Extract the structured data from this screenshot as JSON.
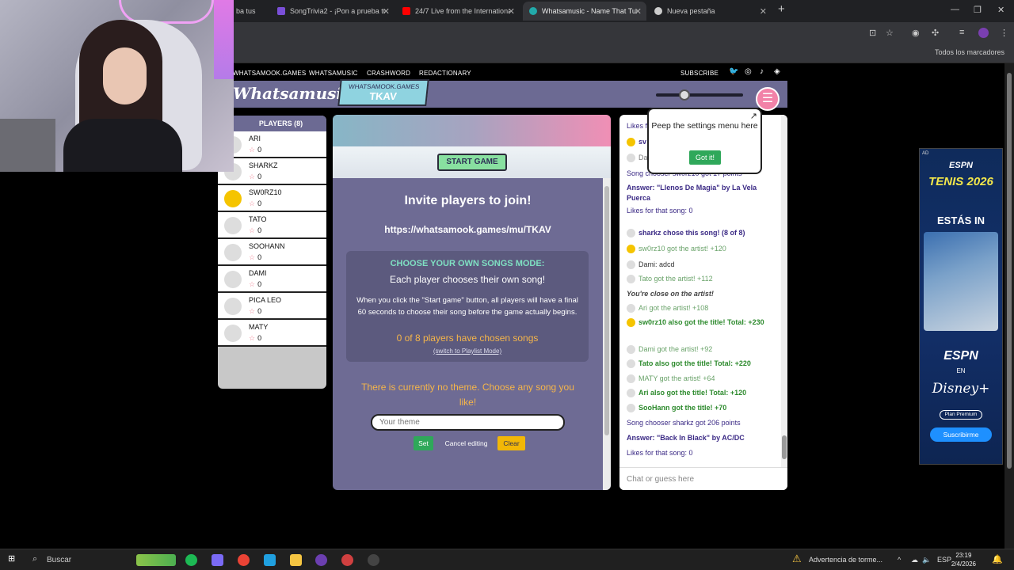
{
  "browser": {
    "tabs": [
      {
        "label": "ba tus",
        "icon": "music-icon",
        "color": "#666"
      },
      {
        "label": "SongTrivia2 - ¡Pon a prueba tus",
        "icon": "songtrivia-icon",
        "color": "#7a4fd8"
      },
      {
        "label": "24/7 Live from the International",
        "icon": "youtube-icon",
        "color": "#ff0000"
      },
      {
        "label": "Whatsamusic - Name That Tune",
        "icon": "whatsamusic-icon",
        "color": "#2aa"
      },
      {
        "label": "Nueva pestaña",
        "icon": "chrome-icon",
        "color": "#ccc"
      }
    ],
    "new_tab": "+",
    "bookmarks_label": "Todos los marcadores"
  },
  "site": {
    "nav": [
      "WHATSAMOOK.GAMES",
      "WHATSAMUSIC",
      "CRASHWORD",
      "REDACTIONARY"
    ],
    "subscribe": "SUBSCRIBE",
    "logo": "Whatsamusic",
    "room_site": "WHATSAMOOK.GAMES",
    "room_code": "TKAV",
    "menu_icon": "hamburger-icon",
    "volume_level": 0.3
  },
  "players": {
    "header": "PLAYERS (8)",
    "list": [
      {
        "name": "ARI",
        "score": "0",
        "gold": false
      },
      {
        "name": "SHARKZ",
        "score": "0",
        "gold": false
      },
      {
        "name": "SW0RZ10",
        "score": "0",
        "gold": true
      },
      {
        "name": "TATO",
        "score": "0",
        "gold": false
      },
      {
        "name": "SOOHANN",
        "score": "0",
        "gold": false
      },
      {
        "name": "DAMI",
        "score": "0",
        "gold": false
      },
      {
        "name": "PICA LEO",
        "score": "0",
        "gold": false
      },
      {
        "name": "MATY",
        "score": "0",
        "gold": false
      }
    ]
  },
  "main": {
    "start_label": "START GAME",
    "invite_title": "Invite players to join!",
    "invite_url": "https://whatsamook.games/mu/TKAV",
    "mode_title": "CHOOSE YOUR OWN SONGS MODE:",
    "mode_subtitle": "Each player chooses their own song!",
    "mode_desc": "When you click the \"Start game\" button, all players will have a final 60 seconds to choose their song before the game actually begins.",
    "mode_count": "0 of 8 players have chosen songs",
    "mode_switch": "(switch to Playlist Mode)",
    "theme_text": "There is currently no theme. Choose any song you like!",
    "theme_placeholder": "Your theme",
    "set_label": "Set",
    "cancel_label": "Cancel editing",
    "clear_label": "Clear"
  },
  "tooltip": {
    "text": "Peep the settings menu here",
    "button": "Got it!"
  },
  "chat": {
    "lines": [
      {
        "text": "Likes f",
        "cls": "c-purple",
        "avatar": false
      },
      {
        "text": "sv",
        "cls": "c-purple-b",
        "avatar": "gold"
      },
      {
        "text": "Da",
        "cls": "c-gray",
        "avatar": "plain"
      },
      {
        "text": "Song chooser sw0rz10 got 17 points",
        "cls": "c-purple",
        "avatar": false
      },
      {
        "text": "Answer: \"Llenos De Magia\" by La Vela Puerca",
        "cls": "c-purple-b",
        "avatar": false
      },
      {
        "text": "Likes for that song: 0",
        "cls": "c-purple",
        "avatar": false
      },
      {
        "text": "sharkz chose this song! (8 of 8)",
        "cls": "c-purple-b",
        "avatar": "plain"
      },
      {
        "text": "sw0rz10 got the artist! +120",
        "cls": "c-green",
        "avatar": "gold"
      },
      {
        "text": "Dami: adcd",
        "cls": "c-dark",
        "avatar": "plain"
      },
      {
        "text": "Tato got the artist! +112",
        "cls": "c-green",
        "avatar": "plain"
      },
      {
        "text": "You're close on the artist!",
        "cls": "c-italic",
        "avatar": false
      },
      {
        "text": "Ari got the artist! +108",
        "cls": "c-green",
        "avatar": "plain"
      },
      {
        "text": "sw0rz10 also got the title! Total: +230",
        "cls": "c-green-b",
        "avatar": "gold"
      },
      {
        "text": "Dami got the artist! +92",
        "cls": "c-green",
        "avatar": "plain"
      },
      {
        "text": "Tato also got the title! Total: +220",
        "cls": "c-green-b",
        "avatar": "plain"
      },
      {
        "text": "MATY got the artist! +64",
        "cls": "c-green",
        "avatar": "plain"
      },
      {
        "text": "Ari also got the title! Total: +120",
        "cls": "c-green-b",
        "avatar": "plain"
      },
      {
        "text": "SooHann got the title! +70",
        "cls": "c-green-b",
        "avatar": "plain"
      },
      {
        "text": "Song chooser sharkz got 206 points",
        "cls": "c-purple",
        "avatar": false
      },
      {
        "text": "Answer: \"Back In Black\" by AC/DC",
        "cls": "c-purple-b",
        "avatar": false
      },
      {
        "text": "Likes for that song: 0",
        "cls": "c-purple",
        "avatar": false
      }
    ],
    "placeholder": "Chat or guess here"
  },
  "ad": {
    "tag": "AD",
    "brand": "ESPN",
    "headline": "TENIS 2026",
    "tagline": "ESTÁS IN",
    "brand2": "ESPN",
    "en": "EN",
    "disney": "Disney+",
    "plan": "Plan Premium",
    "cta": "Suscribirme"
  },
  "taskbar": {
    "search": "Buscar",
    "weather": "Advertencia de torme...",
    "lang": "ESP",
    "time": "23:19",
    "date": "2/4/2026"
  }
}
